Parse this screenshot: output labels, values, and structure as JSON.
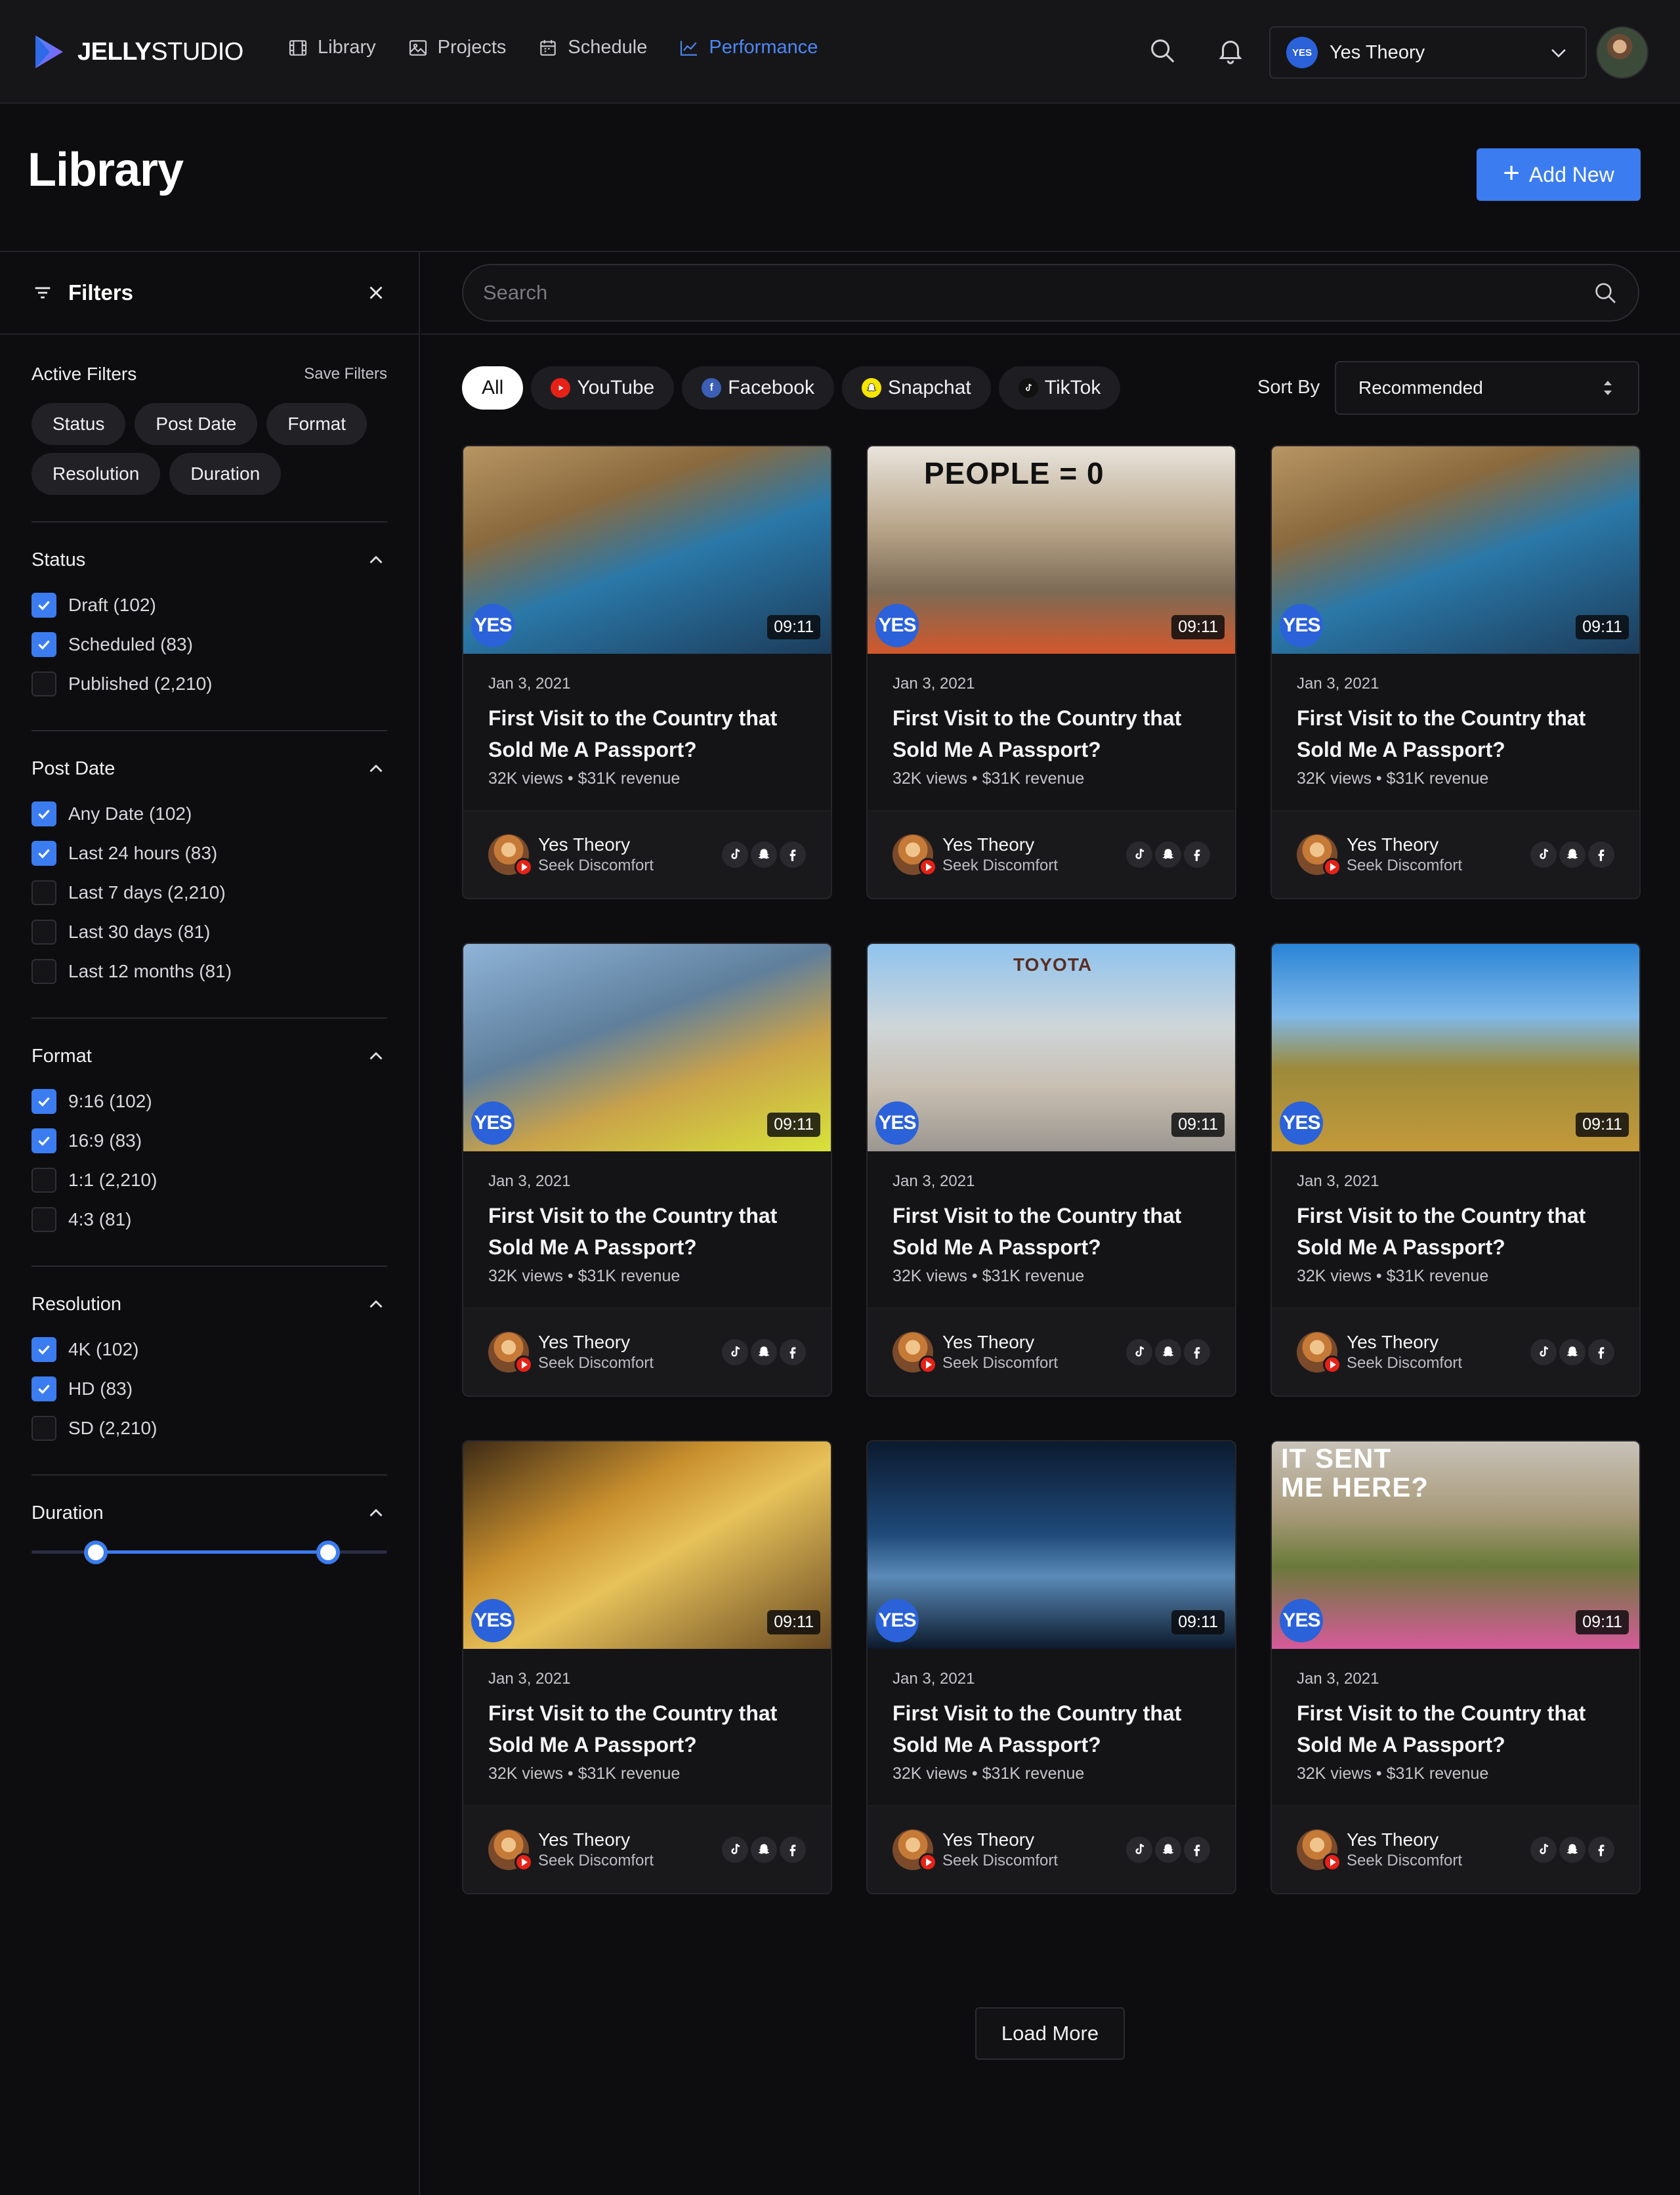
{
  "app": {
    "logo_bold": "JELLY",
    "logo_light": "STUDIO",
    "brand_color": "#3b7cf0"
  },
  "nav": {
    "items": [
      {
        "label": "Library",
        "icon": "film-icon"
      },
      {
        "label": "Projects",
        "icon": "image-icon"
      },
      {
        "label": "Schedule",
        "icon": "calendar-icon"
      },
      {
        "label": "Performance",
        "icon": "line-chart-icon",
        "active": true
      }
    ]
  },
  "account": {
    "badge": "YES",
    "name": "Yes Theory"
  },
  "page": {
    "title": "Library",
    "add_label": "Add New"
  },
  "filters": {
    "title": "Filters",
    "active_title": "Active Filters",
    "save_label": "Save Filters",
    "active_chips": [
      "Status",
      "Post Date",
      "Format",
      "Resolution",
      "Duration"
    ],
    "sections": [
      {
        "title": "Status",
        "options": [
          {
            "label": "Draft (102)",
            "checked": true
          },
          {
            "label": "Scheduled (83)",
            "checked": true
          },
          {
            "label": "Published (2,210)",
            "checked": false
          }
        ]
      },
      {
        "title": "Post Date",
        "options": [
          {
            "label": "Any Date (102)",
            "checked": true
          },
          {
            "label": "Last 24 hours (83)",
            "checked": true
          },
          {
            "label": "Last 7 days (2,210)",
            "checked": false
          },
          {
            "label": "Last 30 days (81)",
            "checked": false
          },
          {
            "label": "Last 12 months (81)",
            "checked": false
          }
        ]
      },
      {
        "title": "Format",
        "options": [
          {
            "label": "9:16 (102)",
            "checked": true
          },
          {
            "label": "16:9 (83)",
            "checked": true
          },
          {
            "label": "1:1 (2,210)",
            "checked": false
          },
          {
            "label": "4:3 (81)",
            "checked": false
          }
        ]
      },
      {
        "title": "Resolution",
        "options": [
          {
            "label": "4K (102)",
            "checked": true
          },
          {
            "label": "HD (83)",
            "checked": true
          },
          {
            "label": "SD (2,210)",
            "checked": false
          }
        ]
      }
    ],
    "duration": {
      "title": "Duration",
      "range_min_fraction": 0.18,
      "range_max_fraction": 0.83
    }
  },
  "search": {
    "placeholder": "Search"
  },
  "platforms": [
    {
      "label": "All",
      "active": true
    },
    {
      "label": "YouTube",
      "icon": "youtube-icon",
      "color": "#e62117"
    },
    {
      "label": "Facebook",
      "icon": "facebook-icon",
      "color": "#3a5fb5"
    },
    {
      "label": "Snapchat",
      "icon": "snapchat-icon",
      "color": "#f5e500"
    },
    {
      "label": "TikTok",
      "icon": "tiktok-icon",
      "color": "#111111"
    }
  ],
  "sort": {
    "label": "Sort By",
    "value": "Recommended"
  },
  "cards": [
    {
      "date": "Jan 3, 2021",
      "title": "First Visit to the Country that Sold Me A Passport?",
      "meta": "32K views • $31K revenue",
      "duration": "09:11",
      "channel": "Yes Theory",
      "subtitle": "Seek Discomfort",
      "thumb_text": "",
      "thumb_bg": "linear-gradient(160deg,#b89563 0%,#8a6a3e 30%,#2a78a8 55%,#1c3c5a 100%)"
    },
    {
      "date": "Jan 3, 2021",
      "title": "First Visit to the Country that Sold Me A Passport?",
      "meta": "32K views • $31K revenue",
      "duration": "09:11",
      "channel": "Yes Theory",
      "subtitle": "Seek Discomfort",
      "thumb_text": "PEOPLE = 0",
      "thumb_bg": "linear-gradient(180deg,#e9e4dc 0%,#b7a488 40%,#7c6a55 70%,#d2582c 100%)"
    },
    {
      "date": "Jan 3, 2021",
      "title": "First Visit to the Country that Sold Me A Passport?",
      "meta": "32K views • $31K revenue",
      "duration": "09:11",
      "channel": "Yes Theory",
      "subtitle": "Seek Discomfort",
      "thumb_text": "",
      "thumb_bg": "linear-gradient(160deg,#b89563 0%,#8a6a3e 30%,#2a78a8 55%,#1c3c5a 100%)"
    },
    {
      "date": "Jan 3, 2021",
      "title": "First Visit to the Country that Sold Me A Passport?",
      "meta": "32K views • $31K revenue",
      "duration": "09:11",
      "channel": "Yes Theory",
      "subtitle": "Seek Discomfort",
      "thumb_text": "",
      "thumb_bg": "linear-gradient(160deg,#8fb4d8 0%,#5f7f9c 40%,#c9a24a 65%,#d8e23a 100%)"
    },
    {
      "date": "Jan 3, 2021",
      "title": "First Visit to the Country that Sold Me A Passport?",
      "meta": "32K views • $31K revenue",
      "duration": "09:11",
      "channel": "Yes Theory",
      "subtitle": "Seek Discomfort",
      "thumb_text": "TOYOTA",
      "thumb_bg": "linear-gradient(180deg,#8fc3ee 0%,#cfd6d9 40%,#c7beb0 70%,#9b9690 100%)"
    },
    {
      "date": "Jan 3, 2021",
      "title": "First Visit to the Country that Sold Me A Passport?",
      "meta": "32K views • $31K revenue",
      "duration": "09:11",
      "channel": "Yes Theory",
      "subtitle": "Seek Discomfort",
      "thumb_text": "",
      "thumb_bg": "linear-gradient(180deg,#2a84d6 0%,#7fb8e8 35%,#9c8a3a 60%,#c49a3a 100%)"
    },
    {
      "date": "Jan 3, 2021",
      "title": "First Visit to the Country that Sold Me A Passport?",
      "meta": "32K views • $31K revenue",
      "duration": "09:11",
      "channel": "Yes Theory",
      "subtitle": "Seek Discomfort",
      "thumb_text": "",
      "thumb_bg": "linear-gradient(150deg,#3d2a16 0%,#c9902e 35%,#e7c25a 55%,#6a4a22 100%)"
    },
    {
      "date": "Jan 3, 2021",
      "title": "First Visit to the Country that Sold Me A Passport?",
      "meta": "32K views • $31K revenue",
      "duration": "09:11",
      "channel": "Yes Theory",
      "subtitle": "Seek Discomfort",
      "thumb_text": "",
      "thumb_bg": "linear-gradient(180deg,#0b1a2e 0%,#1f4a7a 45%,#5a8ab8 65%,#0c1a2c 100%)"
    },
    {
      "date": "Jan 3, 2021",
      "title": "First Visit to the Country that Sold Me A Passport?",
      "meta": "32K views • $31K revenue",
      "duration": "09:11",
      "channel": "Yes Theory",
      "subtitle": "Seek Discomfort",
      "thumb_text": "IT SENT ME HERE?",
      "thumb_bg": "linear-gradient(180deg,#c8c2b8 0%,#a89a7a 35%,#6a7a3a 60%,#d65a9a 100%)"
    }
  ],
  "load_more_label": "Load More"
}
